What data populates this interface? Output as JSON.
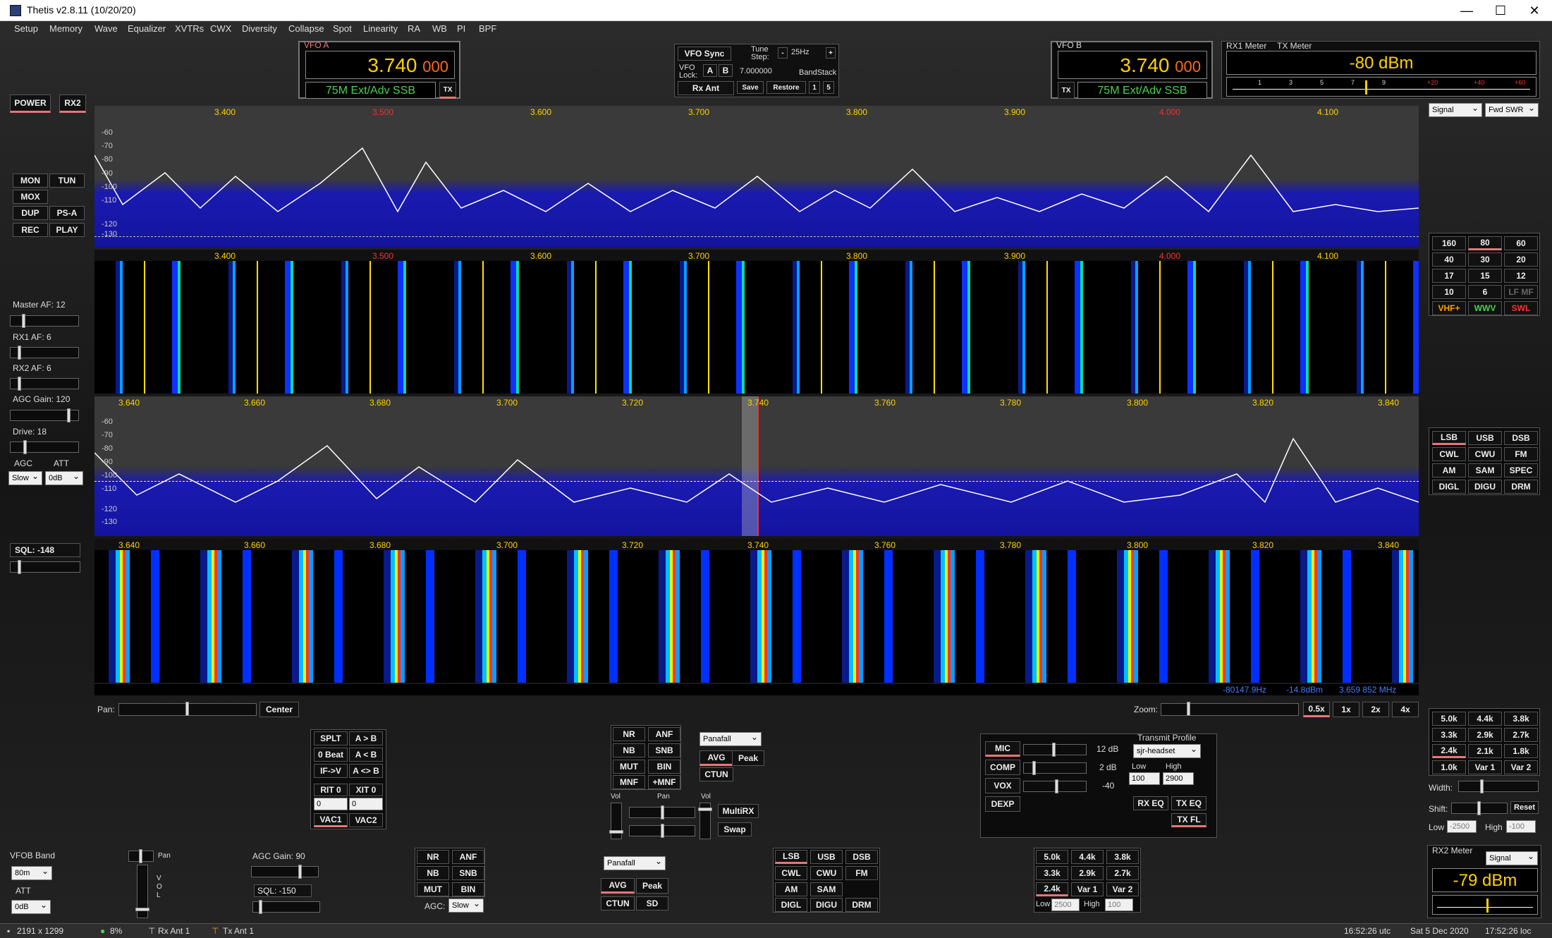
{
  "window": {
    "title": "Thetis v2.8.11 (10/20/20)",
    "minimize": "—",
    "maximize": "☐",
    "close": "✕"
  },
  "menu": [
    "Setup",
    "Memory",
    "Wave",
    "Equalizer",
    "XVTRs",
    "CWX",
    "Diversity",
    "Collapse",
    "Spot",
    "Linearity",
    "RA",
    "WB",
    "PI",
    "BPF"
  ],
  "vfoA": {
    "label": "VFO A",
    "freq_main": "3.740",
    "freq_sub": "000",
    "mode": "75M Ext/Adv SSB",
    "tx": "TX"
  },
  "vfoB": {
    "label": "VFO B",
    "freq_main": "3.740",
    "freq_sub": "000",
    "mode": "75M Ext/Adv SSB",
    "tx": "TX"
  },
  "vfoCenter": {
    "sync": "VFO Sync",
    "tune_step": "Tune Step:",
    "minus": "-",
    "step": "25Hz",
    "plus": "+",
    "lock": "VFO Lock:",
    "a": "A",
    "b": "B",
    "lock_val": "7.000000",
    "bandstack": "BandStack",
    "rxant": "Rx Ant",
    "save": "Save",
    "restore": "Restore",
    "n1": "1",
    "n5": "5"
  },
  "rx1meter": {
    "label1": "RX1 Meter",
    "label2": "TX Meter",
    "value": "-80 dBm",
    "sel1": "Signal",
    "sel2": "Fwd SWR",
    "scale": [
      "1",
      "3",
      "5",
      "7",
      "9",
      "+20",
      "+40",
      "+60"
    ]
  },
  "left": {
    "power": "POWER",
    "rx2": "RX2",
    "mon": "MON",
    "tun": "TUN",
    "mox": "MOX",
    "dup": "DUP",
    "psa": "PS-A",
    "rec": "REC",
    "play": "PLAY",
    "master_af": "Master AF:  12",
    "rx1_af": "RX1 AF:  6",
    "rx2_af": "RX2 AF:  6",
    "agc_gain": "AGC Gain:  120",
    "drive": "Drive:  18",
    "agc": "AGC",
    "att": "ATT",
    "agc_val": "Slow",
    "att_val": "0dB",
    "sql": "SQL:  -148"
  },
  "pan1": {
    "freqs": [
      "3.400",
      "3.500",
      "3.600",
      "3.700",
      "3.800",
      "3.900",
      "4.000",
      "4.100"
    ],
    "db": [
      "-60",
      "-70",
      "-80",
      "-90",
      "-100",
      "-110",
      "-120",
      "-130"
    ]
  },
  "pan2": {
    "freqs": [
      "3.640",
      "3.660",
      "3.680",
      "3.700",
      "3.720",
      "3.740",
      "3.760",
      "3.780",
      "3.800",
      "3.820",
      "3.840"
    ],
    "db": [
      "-60",
      "-70",
      "-80",
      "-90",
      "-100",
      "-110",
      "-120",
      "-130"
    ]
  },
  "readout": {
    "hz": "-80147.9Hz",
    "dbm": "-14.8dBm",
    "mhz": "3.659 852 MHz"
  },
  "bands": [
    "160",
    "80",
    "60",
    "40",
    "30",
    "20",
    "17",
    "15",
    "12",
    "10",
    "6",
    "LF MF",
    "VHF+",
    "WWV",
    "SWL"
  ],
  "modes": [
    "LSB",
    "USB",
    "DSB",
    "CWL",
    "CWU",
    "FM",
    "AM",
    "SAM",
    "SPEC",
    "DIGL",
    "DIGU",
    "DRM"
  ],
  "filters": [
    "5.0k",
    "4.4k",
    "3.8k",
    "3.3k",
    "2.9k",
    "2.7k",
    "2.4k",
    "2.1k",
    "1.8k",
    "1.0k",
    "Var 1",
    "Var 2"
  ],
  "filters2": [
    "5.0k",
    "4.4k",
    "3.8k",
    "3.3k",
    "2.9k",
    "2.7k",
    "2.4k",
    "Var 1",
    "Var 2"
  ],
  "pan_row": {
    "pan": "Pan:",
    "center": "Center",
    "zoom": "Zoom:",
    "z05": "0.5x",
    "z1": "1x",
    "z2": "2x",
    "z4": "4x"
  },
  "split": {
    "splt": "SPLT",
    "a2b": "A > B",
    "zbeat": "0 Beat",
    "alb": "A < B",
    "ifv": "IF->V",
    "aswap": "A <> B",
    "rit": "RIT  0",
    "xit": "XIT  0",
    "rit_val": "0",
    "xit_val": "0",
    "vac1": "VAC1",
    "vac2": "VAC2"
  },
  "dsp": {
    "nr": "NR",
    "anf": "ANF",
    "nb": "NB",
    "snb": "SNB",
    "mut": "MUT",
    "bin": "BIN",
    "mnf": "MNF",
    "pmnf": "+MNF",
    "display": "Panafall",
    "avg": "AVG",
    "peak": "Peak",
    "ctun": "CTUN",
    "vol": "Vol",
    "pan": "Pan",
    "vol2": "Vol",
    "multirx": "MultiRX",
    "swap": "Swap"
  },
  "tx": {
    "mic": "MIC",
    "mic_db": "12 dB",
    "comp": "COMP",
    "comp_db": "2 dB",
    "vox": "VOX",
    "vox_db": "-40",
    "dexp": "DEXP",
    "profile_label": "Transmit Profile",
    "profile": "sjr-headset",
    "low": "Low",
    "high": "High",
    "low_val": "100",
    "high_val": "2900",
    "rxeq": "RX EQ",
    "txeq": "TX EQ",
    "txfl": "TX FL"
  },
  "width": {
    "width": "Width:",
    "shift": "Shift:",
    "reset": "Reset",
    "low": "Low",
    "high": "High",
    "low_val": "-2500",
    "high_val": "-100"
  },
  "rx2": {
    "vfob_band": "VFOB Band",
    "band": "80m",
    "att": "ATT",
    "att_val": "0dB",
    "pan": "Pan",
    "vol": "V O L",
    "agc_gain": "AGC Gain:  90",
    "sql": "SQL:  -150",
    "nr": "NR",
    "anf": "ANF",
    "nb": "NB",
    "snb": "SNB",
    "mut": "MUT",
    "bin": "BIN",
    "agc": "AGC:",
    "agc_val": "Slow",
    "display": "Panafall",
    "avg": "AVG",
    "peak": "Peak",
    "ctun": "CTUN",
    "sd": "SD",
    "low": "Low",
    "high": "High",
    "low_val": "2500",
    "high_val": "100"
  },
  "rx2meter": {
    "label": "RX2 Meter",
    "sel": "Signal",
    "value": "-79 dBm"
  },
  "status": {
    "res": "2191 x 1299",
    "cpu": "8%",
    "rxant": "Rx Ant 1",
    "txant": "Tx Ant 1",
    "utc": "16:52:26 utc",
    "date": "Sat 5 Dec 2020",
    "loc": "17:52:26 loc"
  },
  "colors": {
    "accent": "#e9767a",
    "freq": "#ffd200",
    "mode": "#4cd24c",
    "pan": "#1a1aa8"
  }
}
